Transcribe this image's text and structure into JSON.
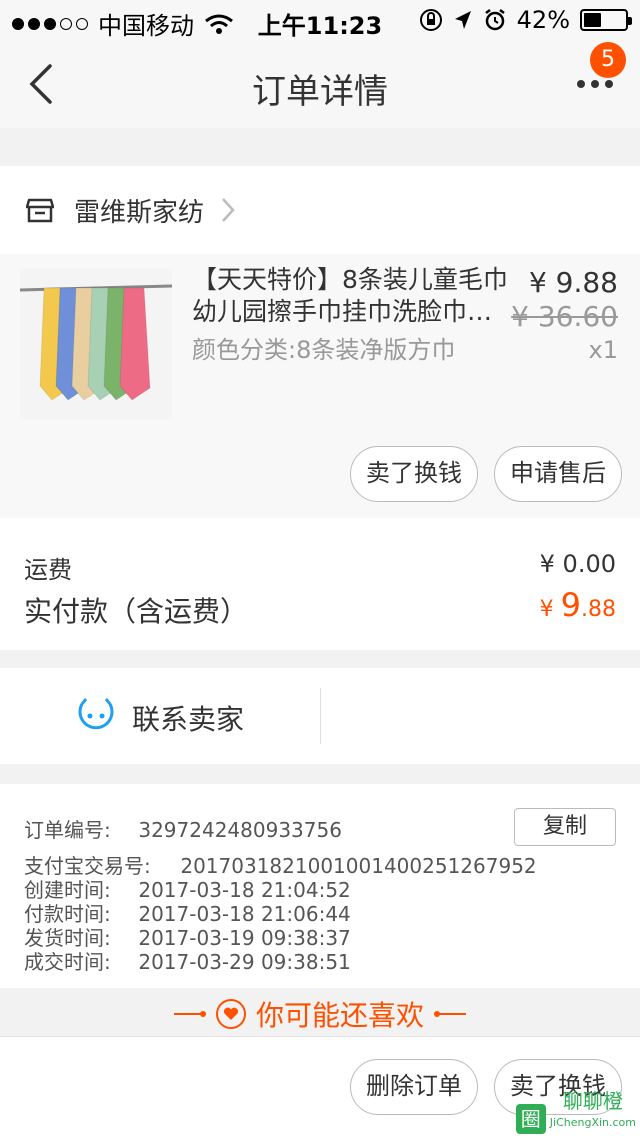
{
  "status_bar": {
    "carrier": "中国移动",
    "time": "上午11:23",
    "battery": "42%",
    "battery_level": 0.42
  },
  "nav": {
    "title": "订单详情",
    "badge": "5"
  },
  "shop": {
    "name": "雷维斯家纺"
  },
  "item": {
    "title_line1": "【天天特价】8条装儿童毛巾",
    "title_line2": "幼儿园擦手巾挂巾洗脸巾…",
    "sku": "颜色分类:8条装净版方巾",
    "price": "¥ 9.88",
    "original_price": "¥ 36.60",
    "qty": "x1",
    "buttons": {
      "sell": "卖了换钱",
      "after_sale": "申请售后"
    },
    "towel_colors": [
      "#f2c94c",
      "#6f8fd8",
      "#e9cf9f",
      "#a8d0b4",
      "#7bb36a",
      "#ee6b86"
    ]
  },
  "fees": {
    "shipping_label": "运费",
    "shipping_value": "¥ 0.00",
    "paid_label": "实付款（含运费）",
    "paid_currency": "¥",
    "paid_int": "9",
    "paid_dec": ".88"
  },
  "contact": {
    "label": "联系卖家"
  },
  "order_info": {
    "order_no_label": "订单编号:",
    "order_no": "3297242480933756",
    "copy_label": "复制",
    "alipay_label": "支付宝交易号:",
    "alipay_no": "2017031821001001400251267952",
    "created_label": "创建时间:",
    "created": "2017-03-18 21:04:52",
    "paid_label": "付款时间:",
    "paid": "2017-03-18 21:06:44",
    "shipped_label": "发货时间:",
    "shipped": "2017-03-19 09:38:37",
    "done_label": "成交时间:",
    "done": "2017-03-29 09:38:51"
  },
  "recommend": {
    "label": "你可能还喜欢"
  },
  "bottom_bar": {
    "delete": "删除订单",
    "sell": "卖了换钱"
  },
  "watermark": {
    "text": "聊聊橙",
    "sub": "JiChengXin.com",
    "box": "圈"
  },
  "colors": {
    "accent": "#ff5000",
    "watermark": "#2fae56"
  }
}
